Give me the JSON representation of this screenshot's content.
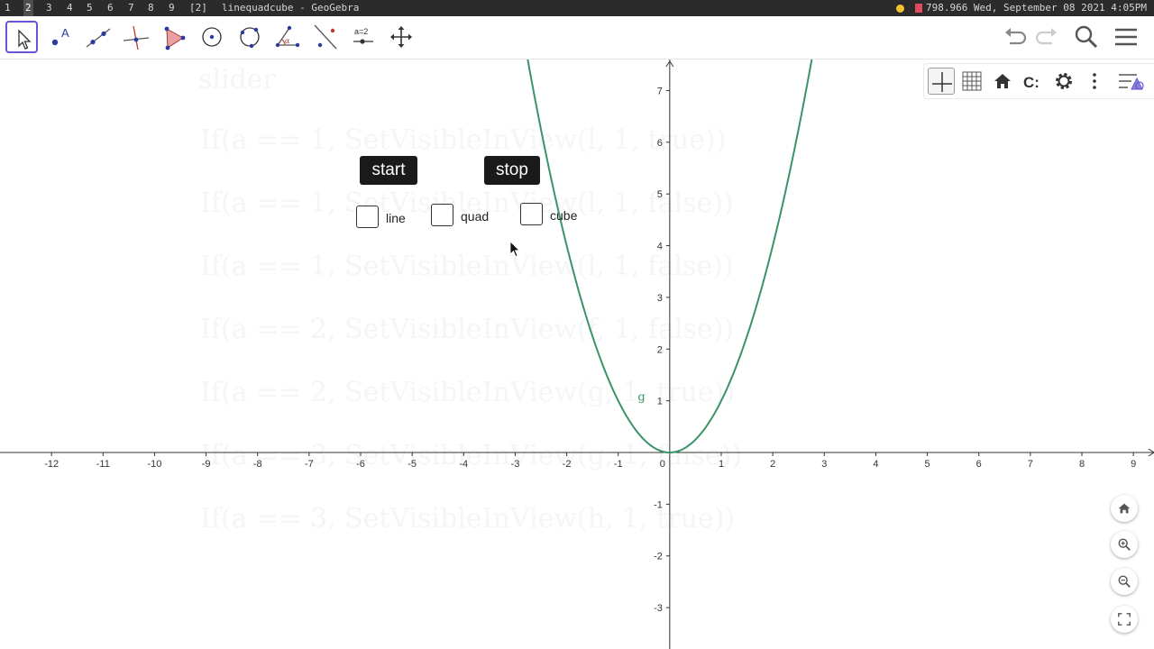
{
  "taskbar": {
    "workspaces": [
      "1",
      "2",
      "3",
      "4",
      "5",
      "6",
      "7",
      "8",
      "9",
      "[2]"
    ],
    "active_workspace": "2",
    "window_title": "linequadcube - GeoGebra",
    "status": "798.966 Wed, September 08 2021  4:05PM"
  },
  "toolbar": {
    "tools": [
      "move-tool",
      "point-tool",
      "line-tool",
      "perpendicular-line-tool",
      "polygon-tool",
      "circle-center-point-tool",
      "circle-three-points-tool",
      "angle-tool",
      "reflect-tool",
      "slider-tool",
      "move-graphics-view-tool"
    ],
    "slider_tool_text": "a=2",
    "angle_tool_text": "α",
    "right_buttons": [
      "undo",
      "redo",
      "search",
      "menu"
    ]
  },
  "style_bar": {
    "buttons": [
      "axes-toggle",
      "grid-toggle",
      "standard-view",
      "point-capture",
      "graphics-settings",
      "more-options",
      "toggle-style-bar"
    ],
    "point_capture_text": "C:"
  },
  "buttons": {
    "start": "start",
    "stop": "stop"
  },
  "checkboxes": [
    {
      "label": "line",
      "checked": false
    },
    {
      "label": "quad",
      "checked": false
    },
    {
      "label": "cube",
      "checked": false
    }
  ],
  "ghost_text": {
    "slider": "slider",
    "script_lines": [
      "If(a == 1, SetVisibleInView(l, 1, true))",
      "If(a == 1, SetVisibleInView(l, 1, false))",
      "If(a == 1, SetVisibleInView(l, 1, false))",
      "If(a == 2, SetVisibleInView(f, 1, false))",
      "If(a == 2, SetVisibleInView(g, 1, true))",
      "If(a == 3, SetVisibleInView(g, 1, false))",
      "If(a == 3, SetVisibleInView(h, 1, true))"
    ]
  },
  "graph": {
    "x_ticks": [
      "-12",
      "-11",
      "-10",
      "-9",
      "-8",
      "-7",
      "-6",
      "-5",
      "-4",
      "-3",
      "-2",
      "-1",
      "0",
      "1",
      "2",
      "3",
      "4",
      "5",
      "6",
      "7",
      "8",
      "9"
    ],
    "y_ticks": [
      "7",
      "6",
      "5",
      "4",
      "3",
      "2",
      "1",
      "-1",
      "-2",
      "-3"
    ],
    "x_range": [
      -13,
      9.4
    ],
    "y_range": [
      -3.8,
      7.6
    ],
    "curve_label": "g",
    "curve_color": "#3a9467",
    "curve_function": "x^2"
  },
  "zoom_controls": [
    "standard-view",
    "zoom-in",
    "zoom-out",
    "fullscreen"
  ]
}
